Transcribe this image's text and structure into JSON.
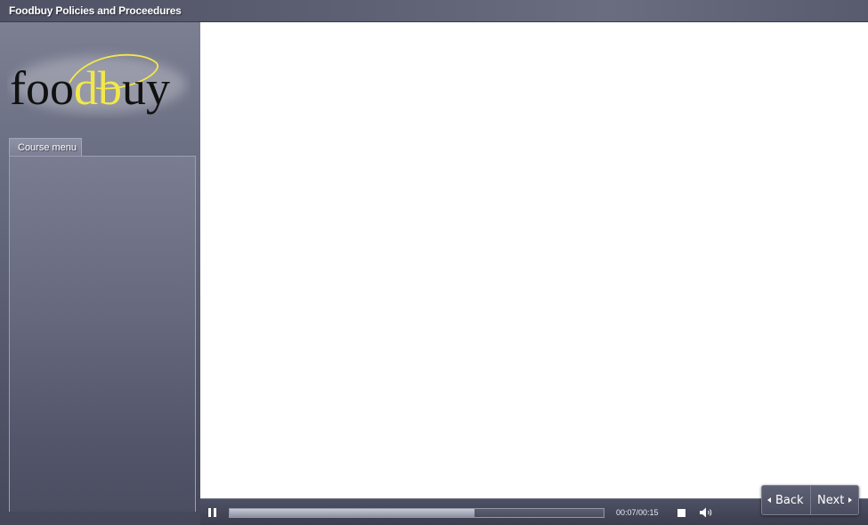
{
  "window": {
    "title": "Foodbuy Policies and Proceedures"
  },
  "sidebar": {
    "logo": {
      "text": "foodbuy",
      "accent_color": "#f2e84a",
      "text_color": "#111111"
    },
    "menu_tab_label": "Course menu"
  },
  "player": {
    "pause_icon": "pause-icon",
    "progress_fraction": 0.655,
    "time": "00:07/00:15",
    "stop_icon": "stop-icon",
    "volume_icon": "volume-icon"
  },
  "navigation": {
    "back_label": "Back",
    "next_label": "Next"
  },
  "colors": {
    "chrome": "#5a5d70",
    "content_background": "#ffffff"
  }
}
